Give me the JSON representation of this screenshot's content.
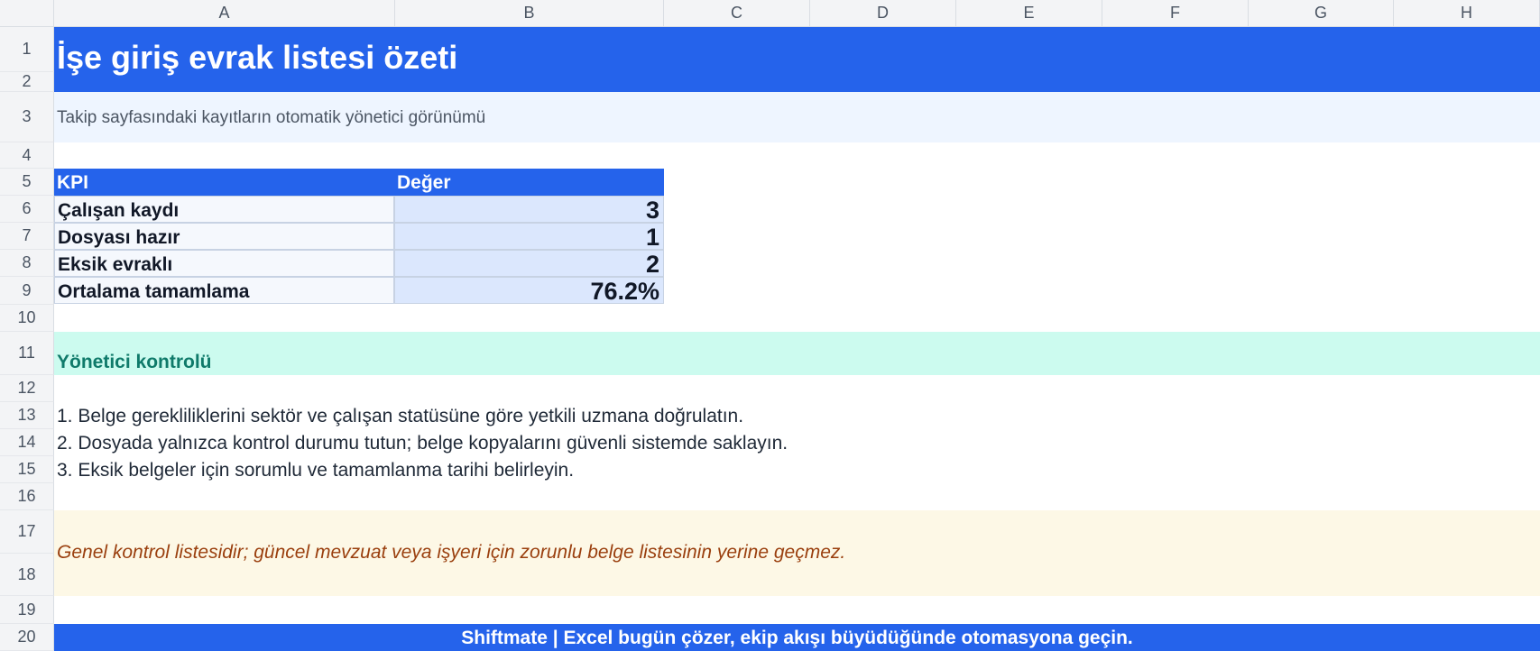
{
  "columns": [
    "A",
    "B",
    "C",
    "D",
    "E",
    "F",
    "G",
    "H"
  ],
  "rows": [
    "1",
    "2",
    "3",
    "4",
    "5",
    "6",
    "7",
    "8",
    "9",
    "10",
    "11",
    "12",
    "13",
    "14",
    "15",
    "16",
    "17",
    "18",
    "19",
    "20"
  ],
  "title": "İşe giriş evrak listesi özeti",
  "subtitle": "Takip sayfasındaki kayıtların otomatik yönetici görünümü",
  "kpi": {
    "header_label": "KPI",
    "header_value": "Değer",
    "rows": [
      {
        "label": "Çalışan kaydı",
        "value": "3"
      },
      {
        "label": "Dosyası hazır",
        "value": "1"
      },
      {
        "label": "Eksik evraklı",
        "value": "2"
      },
      {
        "label": "Ortalama tamamlama",
        "value": "76.2%"
      }
    ]
  },
  "section_title": "Yönetici kontrolü",
  "steps": [
    "1. Belge gerekliliklerini sektör ve çalışan statüsüne göre yetkili uzmana doğrulatın.",
    "2. Dosyada yalnızca kontrol durumu tutun; belge kopyalarını güvenli sistemde saklayın.",
    "3. Eksik belgeler için sorumlu ve tamamlanma tarihi belirleyin."
  ],
  "note": "Genel kontrol listesidir; güncel mevzuat veya işyeri için zorunlu belge listesinin yerine geçmez.",
  "footer": "Shiftmate | Excel bugün çözer, ekip akışı büyüdüğünde otomasyona geçin.",
  "colors": {
    "accent": "#2563eb",
    "subtitle_bg": "#eef5ff",
    "section_bg": "#ccfbef",
    "section_text": "#0f7a6a",
    "note_bg": "#fdf8e6",
    "note_text": "#9a3f0e"
  }
}
